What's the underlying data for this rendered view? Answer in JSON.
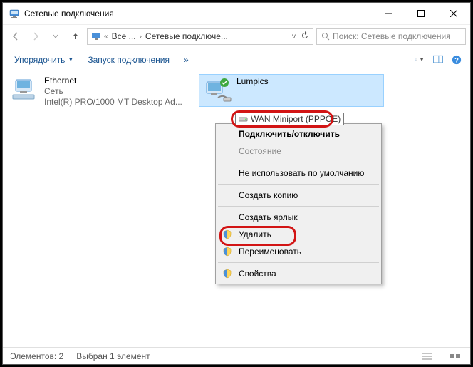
{
  "window": {
    "title": "Сетевые подключения"
  },
  "address": {
    "crumb1": "Все ...",
    "crumb2": "Сетевые подключе..."
  },
  "search": {
    "placeholder": "Поиск: Сетевые подключения"
  },
  "toolbar": {
    "organize": "Упорядочить",
    "launch": "Запуск подключения",
    "more": "»"
  },
  "items": {
    "ethernet": {
      "name": "Ethernet",
      "line2": "Сеть",
      "line3": "Intel(R) PRO/1000 MT Desktop Ad..."
    },
    "lumpics": {
      "name": "Lumpics",
      "adapter": "WAN Miniport (PPPOE)"
    }
  },
  "context": {
    "connect": "Подключить/отключить",
    "status": "Состояние",
    "notdefault": "Не использовать по умолчанию",
    "copy": "Создать копию",
    "shortcut": "Создать ярлык",
    "delete": "Удалить",
    "rename": "Переименовать",
    "properties": "Свойства"
  },
  "statusbar": {
    "count": "Элементов: 2",
    "selected": "Выбран 1 элемент"
  }
}
